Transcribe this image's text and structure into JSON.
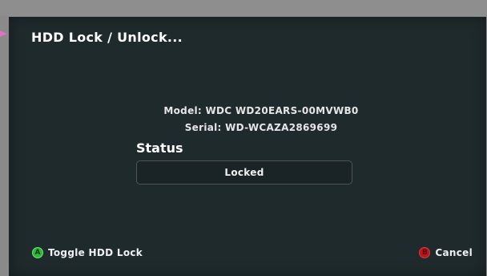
{
  "dialog": {
    "title": "HDD Lock / Unlock..."
  },
  "drive": {
    "model_text": "Model: WDC WD20EARS-00MVWB0",
    "serial_text": "Serial: WD-WCAZA2869699"
  },
  "status": {
    "label": "Status",
    "value": "Locked"
  },
  "footer": {
    "primary": {
      "button_glyph": "A",
      "label": "Toggle HDD Lock",
      "color": "#2fb838"
    },
    "secondary": {
      "button_glyph": "B",
      "label": "Cancel",
      "color": "#b8161e"
    }
  }
}
